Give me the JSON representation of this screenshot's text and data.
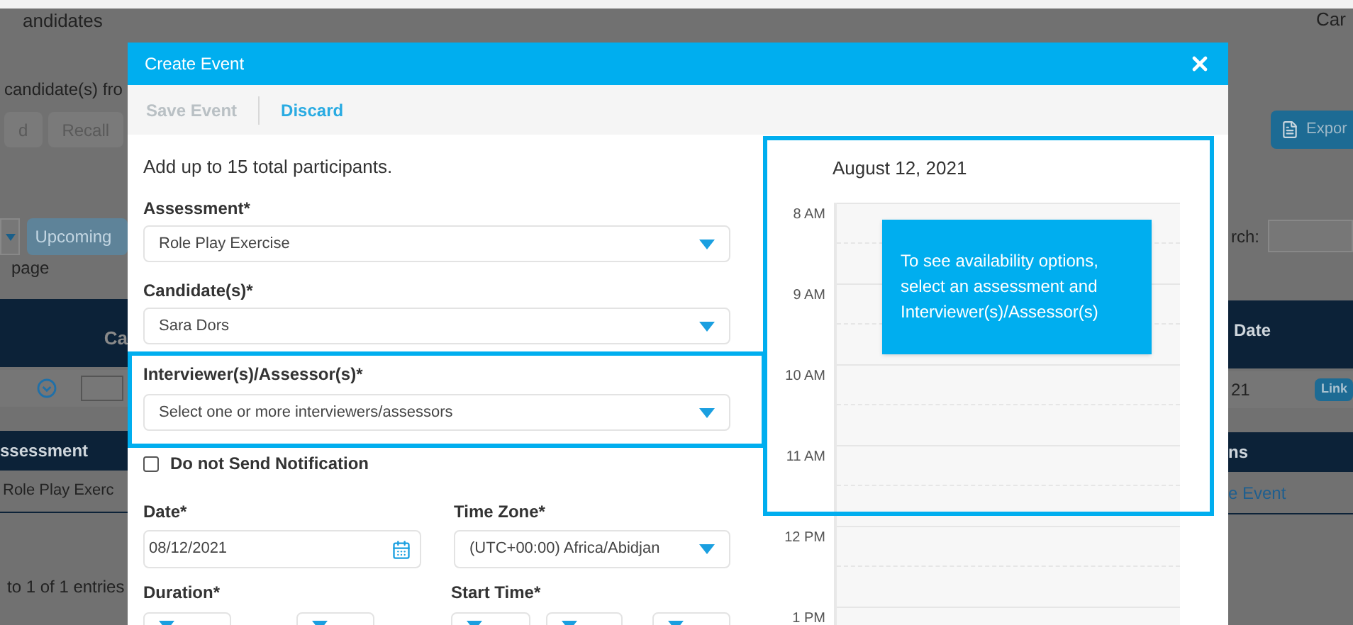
{
  "background_page": {
    "title": "andidates",
    "title_right": "Car",
    "instruction": "candidate(s) fro",
    "buttons": [
      "d",
      "Recall"
    ],
    "export_button": "Expor",
    "filter_button": "Upcoming",
    "page_text": "page",
    "search_label": "rch:",
    "table1": {
      "columns": [
        "Ca",
        "Date"
      ],
      "cell": "21",
      "link": "Link"
    },
    "table2": {
      "columns": [
        "ssessment",
        "ns"
      ],
      "cell": "Role Play Exerc",
      "action": "e Event"
    },
    "entries_info": "to 1 of 1 entries"
  },
  "dialog": {
    "title": "Create Event",
    "toolbar": [
      {
        "label": "Save Event",
        "disabled": true
      },
      {
        "label": "Discard",
        "disabled": false
      }
    ],
    "intro": "Add up to 15 total participants.",
    "fields": [
      {
        "label": "Assessment*",
        "value": "Role Play Exercise",
        "highlighted": false
      },
      {
        "label": "Candidate(s)*",
        "value": "Sara Dors",
        "highlighted": false
      },
      {
        "label": "Interviewer(s)/Assessor(s)*",
        "placeholder": "Select one or more interviewers/assessors",
        "highlighted": true
      }
    ],
    "notification": {
      "label": "Do not Send Notification",
      "checked": false
    },
    "date": {
      "label": "Date*",
      "value": "08/12/2021"
    },
    "time_zone": {
      "label": "Time Zone*",
      "value": "(UTC+00:00) Africa/Abidjan"
    },
    "duration": {
      "label": "Duration*"
    },
    "start_time": {
      "label": "Start Time*"
    },
    "calendar": {
      "date": "August 12, 2021",
      "highlighted": true,
      "hours": [
        "8 AM",
        "9 AM",
        "10 AM",
        "11 AM",
        "12 PM",
        "1 PM"
      ],
      "notice": "To see availability options, select an assessment and Interviewer(s)/Assessor(s)"
    }
  }
}
